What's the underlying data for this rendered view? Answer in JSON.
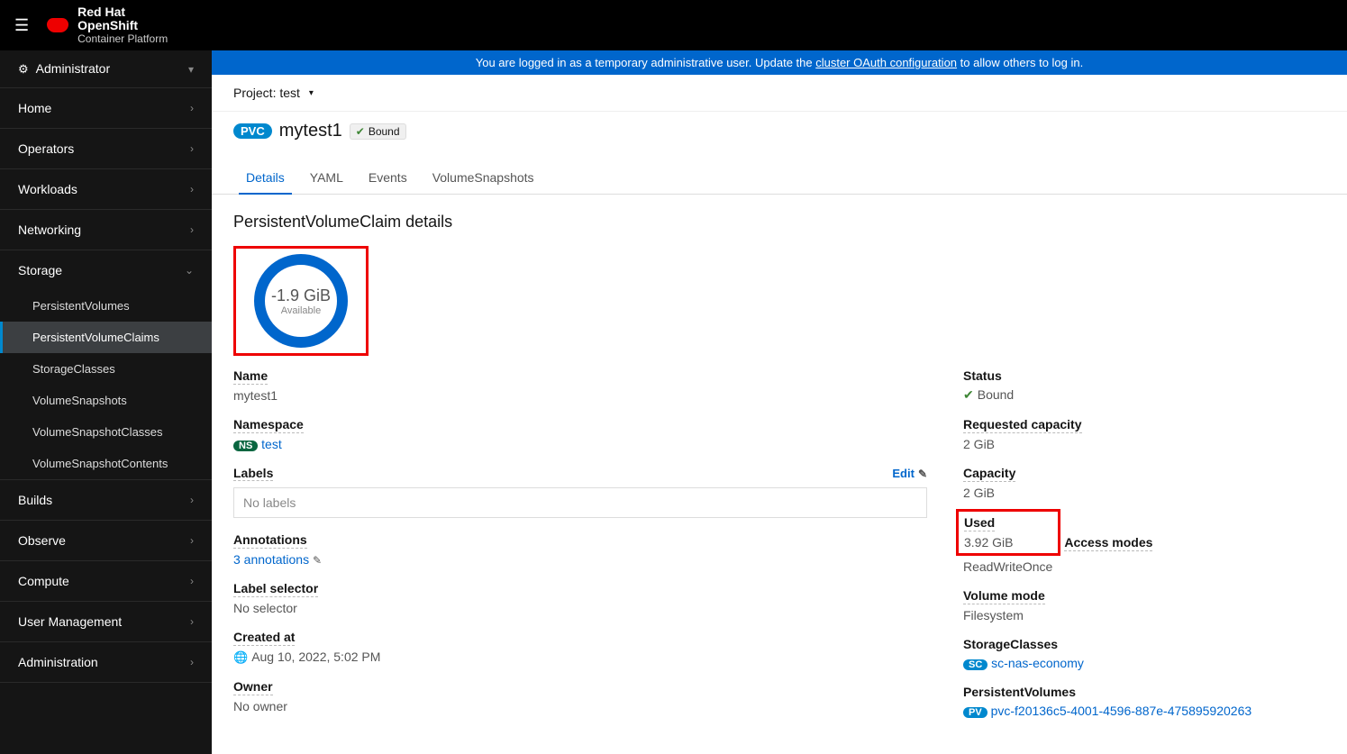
{
  "brand": {
    "line1a": "Red Hat",
    "line1b": "OpenShift",
    "line2": "Container Platform"
  },
  "banner": {
    "pre": "You are logged in as a temporary administrative user. Update the ",
    "link": "cluster OAuth configuration",
    "post": " to allow others to log in."
  },
  "perspective": "Administrator",
  "nav": {
    "home": "Home",
    "operators": "Operators",
    "workloads": "Workloads",
    "networking": "Networking",
    "storage": "Storage",
    "storage_items": [
      "PersistentVolumes",
      "PersistentVolumeClaims",
      "StorageClasses",
      "VolumeSnapshots",
      "VolumeSnapshotClasses",
      "VolumeSnapshotContents"
    ],
    "builds": "Builds",
    "observe": "Observe",
    "compute": "Compute",
    "user_mgmt": "User Management",
    "administration": "Administration"
  },
  "project_label": "Project: test",
  "badge": "PVC",
  "title": "mytest1",
  "status_text": "Bound",
  "tabs": [
    "Details",
    "YAML",
    "Events",
    "VolumeSnapshots"
  ],
  "section_heading": "PersistentVolumeClaim details",
  "donut": {
    "value": "-1.9 GiB",
    "label": "Available"
  },
  "left": {
    "name_label": "Name",
    "name_value": "mytest1",
    "ns_label": "Namespace",
    "ns_pill": "NS",
    "ns_value": "test",
    "labels_label": "Labels",
    "labels_empty": "No labels",
    "edit": "Edit",
    "annotations_label": "Annotations",
    "annotations_value": "3 annotations",
    "selector_label": "Label selector",
    "selector_value": "No selector",
    "created_label": "Created at",
    "created_value": "Aug 10, 2022, 5:02 PM",
    "owner_label": "Owner",
    "owner_value": "No owner"
  },
  "right": {
    "status_label": "Status",
    "status_value": "Bound",
    "req_label": "Requested capacity",
    "req_value": "2 GiB",
    "cap_label": "Capacity",
    "cap_value": "2 GiB",
    "used_label": "Used",
    "used_value": "3.92 GiB",
    "access_label": "Access modes",
    "access_value": "ReadWriteOnce",
    "vmode_label": "Volume mode",
    "vmode_value": "Filesystem",
    "sc_label": "StorageClasses",
    "sc_pill": "SC",
    "sc_value": "sc-nas-economy",
    "pv_label": "PersistentVolumes",
    "pv_pill": "PV",
    "pv_value": "pvc-f20136c5-4001-4596-887e-475895920263"
  }
}
